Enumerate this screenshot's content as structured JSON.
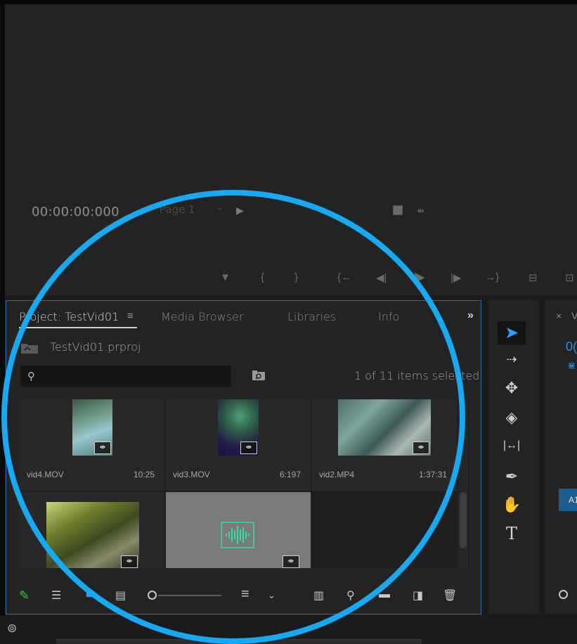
{
  "monitor": {
    "timecode": "00:00:00:000",
    "page_label": "Page 1",
    "page_chevron": "⌄",
    "play_icon": "▶",
    "controls": [
      "▼",
      "{",
      "}",
      "{←",
      "◀|",
      "▶",
      "|▶",
      "→}",
      "⊟",
      "⊡"
    ]
  },
  "project_panel": {
    "tabs": [
      {
        "label": "Project: TestVid01"
      },
      {
        "label": "Media Browser"
      },
      {
        "label": "Libraries"
      },
      {
        "label": "Info"
      }
    ],
    "menu_icon": "≡",
    "overflow_icon": "»",
    "project_file": "TestVid01.prproj",
    "search": {
      "placeholder": "",
      "value": ""
    },
    "search_glyph": "⚲",
    "selection_status": "1 of 11 items selected",
    "items": [
      {
        "name": "vid4.MOV",
        "duration": "10:25",
        "badge": "⇼"
      },
      {
        "name": "vid3.MOV",
        "duration": "6:197",
        "badge": "⇼"
      },
      {
        "name": "vid2.MP4",
        "duration": "1:37:31",
        "badge": "⇼"
      },
      {
        "name": "",
        "duration": "",
        "badge": "⇼"
      },
      {
        "name": "",
        "duration": "",
        "badge": "⇼"
      }
    ],
    "toolbar": {
      "pencil": "✎",
      "list_view": "☰",
      "icon_view": "■",
      "freeform_view": "▤",
      "sort": "≡",
      "sort_chevron": "⌄",
      "automate": "▥",
      "find": "⚲",
      "new_bin": "▬",
      "new_item": "◨",
      "clear": "🗑"
    }
  },
  "tools": {
    "select": "➤",
    "track_select": "⇢",
    "ripple_edit": "✥",
    "razor": "◈",
    "slip": "|↔|",
    "pen": "✒",
    "hand": "✋",
    "type": "T"
  },
  "timeline": {
    "close": "×",
    "name_fragment": "V",
    "time_fragment": "0(",
    "snap_icon": "⋇",
    "track_label": "A1"
  },
  "statusbar": {
    "cc_icon": "⊚"
  },
  "colors": {
    "accent_blue": "#2e9bff",
    "annotation_ring": "#17a9f1",
    "panel_bg": "#232323",
    "audio_waveform": "#2fe0a6"
  }
}
